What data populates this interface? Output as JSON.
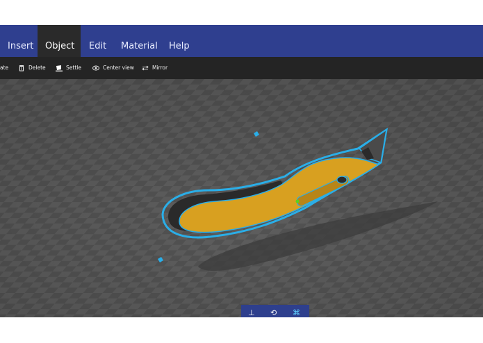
{
  "menu": {
    "items": [
      {
        "label": "Insert"
      },
      {
        "label": "Object",
        "active": true
      },
      {
        "label": "Edit"
      },
      {
        "label": "Material"
      },
      {
        "label": "Help"
      }
    ]
  },
  "toolbar": {
    "rotate_label": "ate",
    "delete_label": "Delete",
    "settle_label": "Settle",
    "center_view_label": "Center view",
    "mirror_label": "Mirror"
  },
  "icons": {
    "delete": "trash-icon",
    "settle": "settle-icon",
    "center_view": "eye-icon",
    "mirror": "mirror-arrows-icon"
  },
  "gizmo": {
    "move_glyph": "⊥",
    "rotate_glyph": "⟲",
    "scale_glyph": "⌘"
  },
  "colors": {
    "menubar": "#2f3f8f",
    "toolbar": "#242424",
    "viewport": "#5a5a5a",
    "object_yellow": "#d8a020",
    "selection_outline": "#2aaee8"
  }
}
